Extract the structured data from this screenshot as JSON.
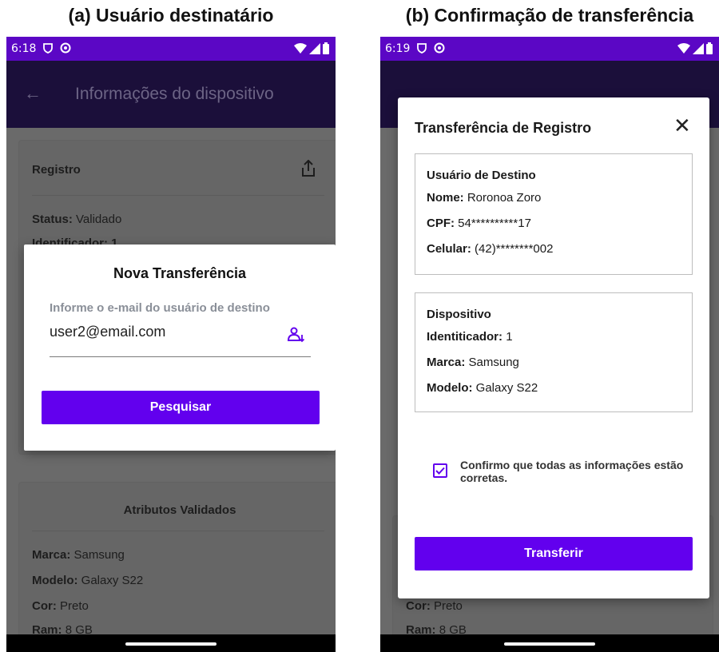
{
  "captions": {
    "a": "(a) Usuário destinatário",
    "b": "(b) Confirmação de transferência"
  },
  "screen_a": {
    "status_time": "6:18",
    "appbar_title": "Informações do dispositivo",
    "bg_card1": {
      "title": "Registro",
      "status_label": "Status:",
      "status_value": "Validado",
      "id_partial": "Identificador: 1"
    },
    "bg_card2": {
      "title": "Atributos Validados",
      "rows": [
        {
          "label": "Marca:",
          "value": "Samsung"
        },
        {
          "label": "Modelo:",
          "value": "Galaxy S22"
        },
        {
          "label": "Cor:",
          "value": "Preto"
        },
        {
          "label": "Ram:",
          "value": "8 GB"
        }
      ]
    },
    "dialog": {
      "title": "Nova Transferência",
      "field_label": "Informe o e-mail do usuário de destino",
      "email_value": "user2@email.com",
      "field_icon": "person-arrow-down-icon",
      "button": "Pesquisar"
    }
  },
  "screen_b": {
    "status_time": "6:19",
    "bg_rows": [
      {
        "label": "Cor:",
        "value": "Preto"
      },
      {
        "label": "Ram:",
        "value": "8 GB"
      }
    ],
    "dialog": {
      "title": "Transferência de Registro",
      "close_icon": "close-icon",
      "dest": {
        "heading": "Usuário de Destino",
        "name_label": "Nome:",
        "name_value": "Roronoa Zoro",
        "cpf_label": "CPF:",
        "cpf_value": "54**********17",
        "phone_label": "Celular:",
        "phone_value": "(42)********002"
      },
      "device": {
        "heading": "Dispositivo",
        "id_label": "Identiticador:",
        "id_value": "1",
        "brand_label": "Marca:",
        "brand_value": "Samsung",
        "model_label": "Modelo:",
        "model_value": "Galaxy S22"
      },
      "confirm_text": "Confirmo que todas as informações estão corretas.",
      "confirm_checked": true,
      "button": "Transferir"
    }
  },
  "colors": {
    "accent": "#6200ee",
    "statusbar": "#5b07c5",
    "appbar_dimmed": "#1b0f3a"
  }
}
